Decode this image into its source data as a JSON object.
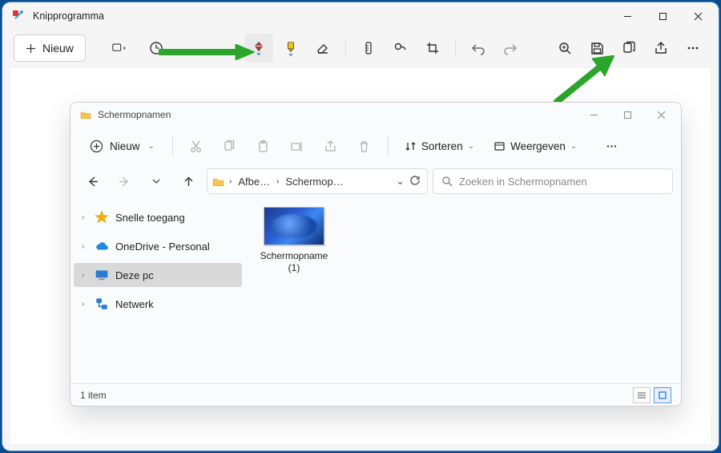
{
  "app": {
    "title": "Knipprogramma",
    "new_label": "Nieuw"
  },
  "explorer": {
    "title": "Schermopnamen",
    "new_label": "Nieuw",
    "sort_label": "Sorteren",
    "view_label": "Weergeven",
    "address": {
      "seg1": "Afbe…",
      "seg2": "Schermop…"
    },
    "search_placeholder": "Zoeken in Schermopnamen",
    "nav": {
      "quick": "Snelle toegang",
      "onedrive": "OneDrive - Personal",
      "thispc": "Deze pc",
      "network": "Netwerk"
    },
    "file": {
      "name": "Schermopname (1)"
    },
    "status": "1 item"
  }
}
